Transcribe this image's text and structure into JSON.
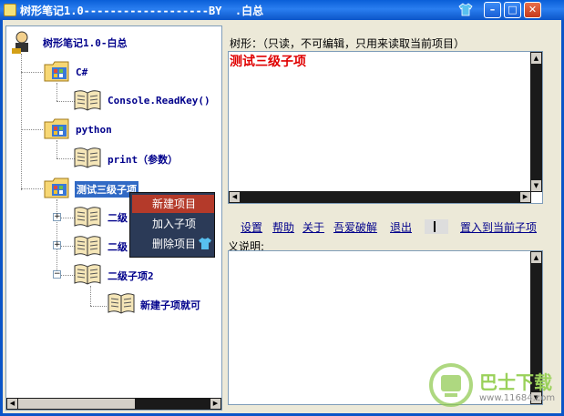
{
  "window": {
    "title": "树形笔记1.0-------------------BY  .白总"
  },
  "tree": {
    "root": "树形笔记1.0-白总",
    "nodes": [
      {
        "label": "C#",
        "children": [
          "Console.ReadKey()"
        ]
      },
      {
        "label": "python",
        "children": [
          "print（参数）"
        ]
      },
      {
        "label": "测试三级子项",
        "selected": true,
        "children": [
          "二级",
          "二级",
          "二级子项2"
        ],
        "grandchild": "新建子项就可"
      }
    ]
  },
  "context_menu": {
    "items": [
      "新建项目",
      "加入子项",
      "删除项目"
    ],
    "highlighted": 0
  },
  "right": {
    "tree_label": "树形：（只读，不可编辑，只用来读取当前项目）",
    "current_node": "测试三级子项",
    "menu": [
      "设置",
      "帮助",
      "关于",
      "吾爱破解",
      "退出",
      "置入到当前子项"
    ],
    "desc_label": "义说明:"
  },
  "watermark": {
    "brand": "巴士下载",
    "url": "www.11684.com"
  },
  "colors": {
    "titlebar": "#0b55c8",
    "selection": "#316ac5",
    "node_text": "#00008b",
    "content_red": "#e00000"
  }
}
